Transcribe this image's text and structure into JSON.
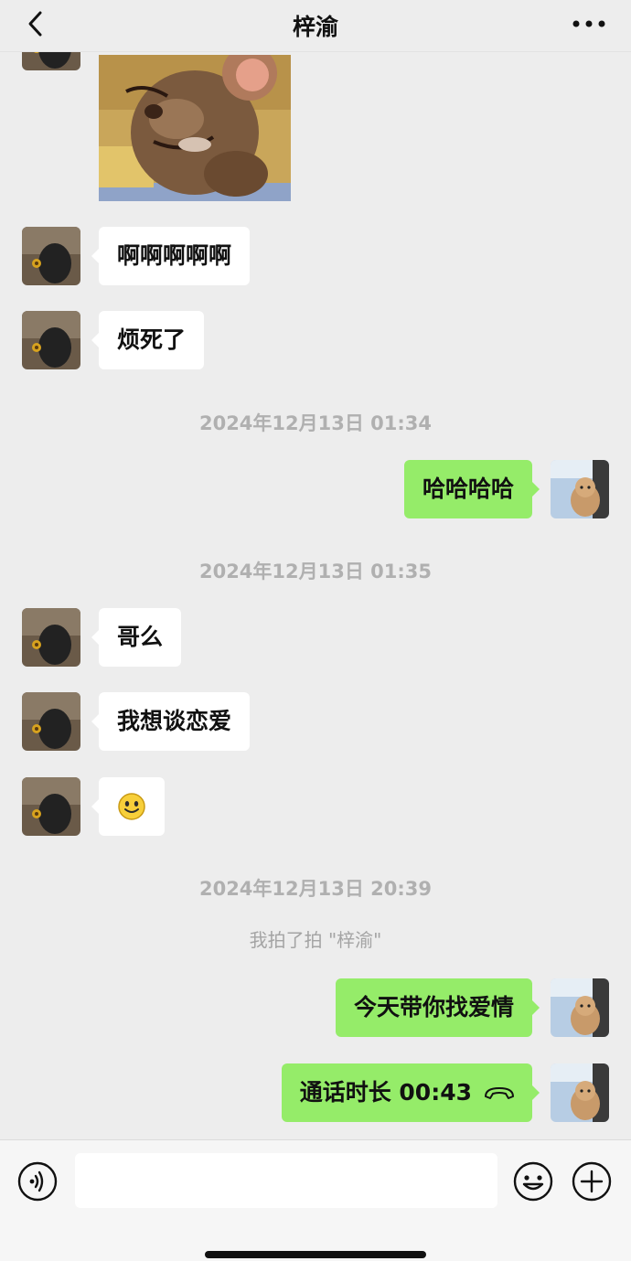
{
  "header": {
    "title": "梓渝",
    "back_icon": "chevron-left-icon",
    "more_icon": "more-dots-icon"
  },
  "messages": [
    {
      "type": "image",
      "side": "in",
      "alt_icon": "cartoon-mouse-sticker"
    },
    {
      "type": "text",
      "side": "in",
      "text": "啊啊啊啊啊"
    },
    {
      "type": "text",
      "side": "in",
      "text": "烦死了"
    },
    {
      "type": "time",
      "text": "2024年12月13日 01:34"
    },
    {
      "type": "text",
      "side": "out",
      "text": "哈哈哈哈"
    },
    {
      "type": "time",
      "text": "2024年12月13日 01:35"
    },
    {
      "type": "text",
      "side": "in",
      "text": "哥么"
    },
    {
      "type": "text",
      "side": "in",
      "text": "我想谈恋爱"
    },
    {
      "type": "emoji",
      "side": "in",
      "icon": "smiley-emoji-icon"
    },
    {
      "type": "time",
      "text": "2024年12月13日 20:39"
    },
    {
      "type": "system",
      "text": "我拍了拍 \"梓渝\""
    },
    {
      "type": "text",
      "side": "out",
      "text": "今天带你找爱情"
    },
    {
      "type": "call",
      "side": "out",
      "text": "通话时长 00:43",
      "icon": "phone-hangup-icon"
    }
  ],
  "input_bar": {
    "voice_icon": "voice-icon",
    "input_value": "",
    "emoji_icon": "emoji-icon",
    "plus_icon": "plus-icon"
  },
  "colors": {
    "background": "#ededed",
    "incoming_bubble": "#ffffff",
    "outgoing_bubble": "#95ec69",
    "timestamp": "#b0b0b0"
  }
}
